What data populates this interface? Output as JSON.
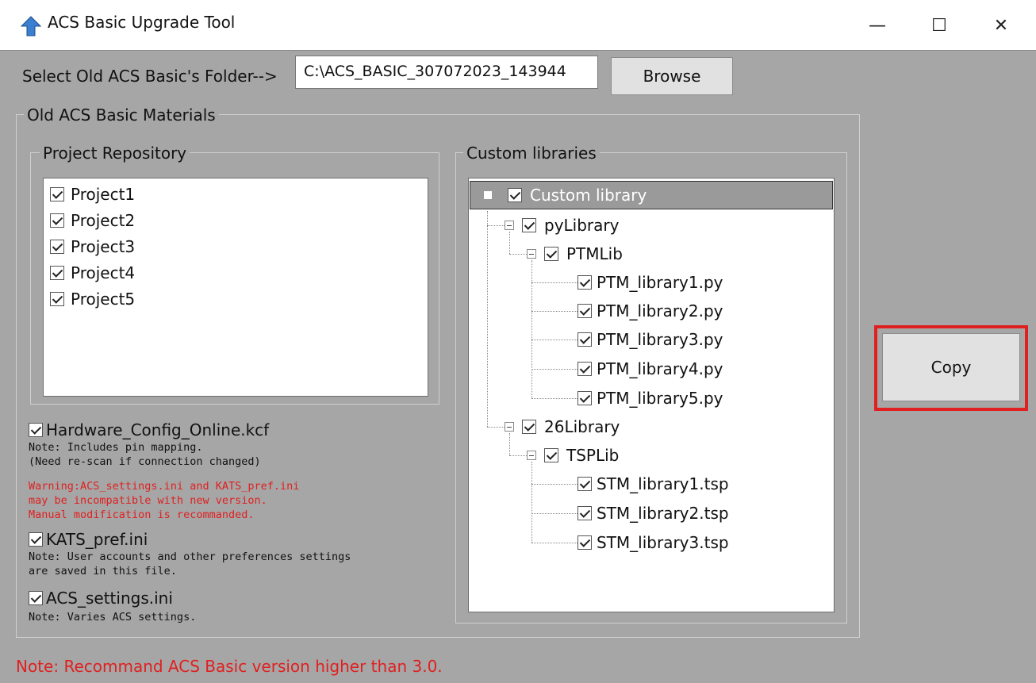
{
  "window": {
    "title": "ACS Basic Upgrade Tool",
    "controls": {
      "minimize": "—",
      "maximize": "☐",
      "close": "✕"
    }
  },
  "folder_select": {
    "label": "Select Old ACS Basic's Folder-->",
    "path_value": "C:\\ACS_BASIC_307072023_143944",
    "browse_label": "Browse"
  },
  "materials": {
    "group_label": "Old ACS Basic Materials",
    "project_repository": {
      "label": "Project Repository",
      "items": [
        {
          "label": "Project1",
          "checked": true
        },
        {
          "label": "Project2",
          "checked": true
        },
        {
          "label": "Project3",
          "checked": true
        },
        {
          "label": "Project4",
          "checked": true
        },
        {
          "label": "Project5",
          "checked": true
        }
      ]
    },
    "hardware_config": {
      "label": "Hardware_Config_Online.kcf",
      "checked": true,
      "note": "Note: Includes pin mapping.\n(Need re-scan if connection changed)"
    },
    "warning": "Warning:ACS_settings.ini and KATS_pref.ini\nmay be incompatible with new version.\nManual modification is recommanded.",
    "kats_pref": {
      "label": "KATS_pref.ini",
      "checked": true,
      "note": "Note: User accounts and other preferences settings\nare saved in this file."
    },
    "acs_settings": {
      "label": "ACS_settings.ini",
      "checked": true,
      "note": "Note: Varies ACS settings."
    },
    "custom_libraries": {
      "label": "Custom libraries",
      "root": "Custom library",
      "py_library": "pyLibrary",
      "ptm_lib": "PTMLib",
      "ptm_files": [
        "PTM_library1.py",
        "PTM_library2.py",
        "PTM_library3.py",
        "PTM_library4.py",
        "PTM_library5.py"
      ],
      "t26_library": "26Library",
      "tsp_lib": "TSPLib",
      "stm_files": [
        "STM_library1.tsp",
        "STM_library2.tsp",
        "STM_library3.tsp"
      ]
    }
  },
  "copy_label": "Copy",
  "bottom_note": "Note: Recommand ACS Basic version higher than 3.0.",
  "colors": {
    "highlight_border": "#e02020",
    "window_bg": "#a6a6a6",
    "warning_text": "#e02020"
  }
}
